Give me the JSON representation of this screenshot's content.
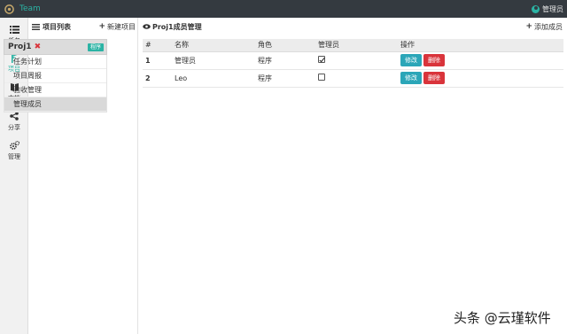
{
  "topbar": {
    "app_title": "Team",
    "user_label": "管理员"
  },
  "leftnav": {
    "items": [
      {
        "label": "任务",
        "icon": "list-icon"
      },
      {
        "label": "项目",
        "icon": "flag-icon",
        "active": true
      },
      {
        "label": "文档",
        "icon": "book-icon"
      },
      {
        "label": "分享",
        "icon": "share-icon"
      },
      {
        "label": "管理",
        "icon": "gears-icon"
      }
    ]
  },
  "project_panel": {
    "title": "项目列表",
    "new_label": "新建项目",
    "project": {
      "name": "Proj1",
      "tag": "程序"
    },
    "menu": [
      "任务计划",
      "项目周报",
      "验收管理",
      "管理成员"
    ]
  },
  "main": {
    "title": "Proj1成员管理",
    "add_label": "添加成员",
    "table": {
      "headers": [
        "#",
        "名称",
        "角色",
        "管理员",
        "操作"
      ],
      "rows": [
        {
          "num": "1",
          "name": "管理员",
          "role": "程序",
          "admin": true,
          "edit": "修改",
          "delete": "删除"
        },
        {
          "num": "2",
          "name": "Leo",
          "role": "程序",
          "admin": false,
          "edit": "修改",
          "delete": "删除"
        }
      ]
    }
  },
  "watermark": "头条 @云瑾软件",
  "colors": {
    "topbar": "#343a40",
    "accent": "#2bb3a4",
    "danger": "#d9343b",
    "info": "#2ba6b8"
  }
}
